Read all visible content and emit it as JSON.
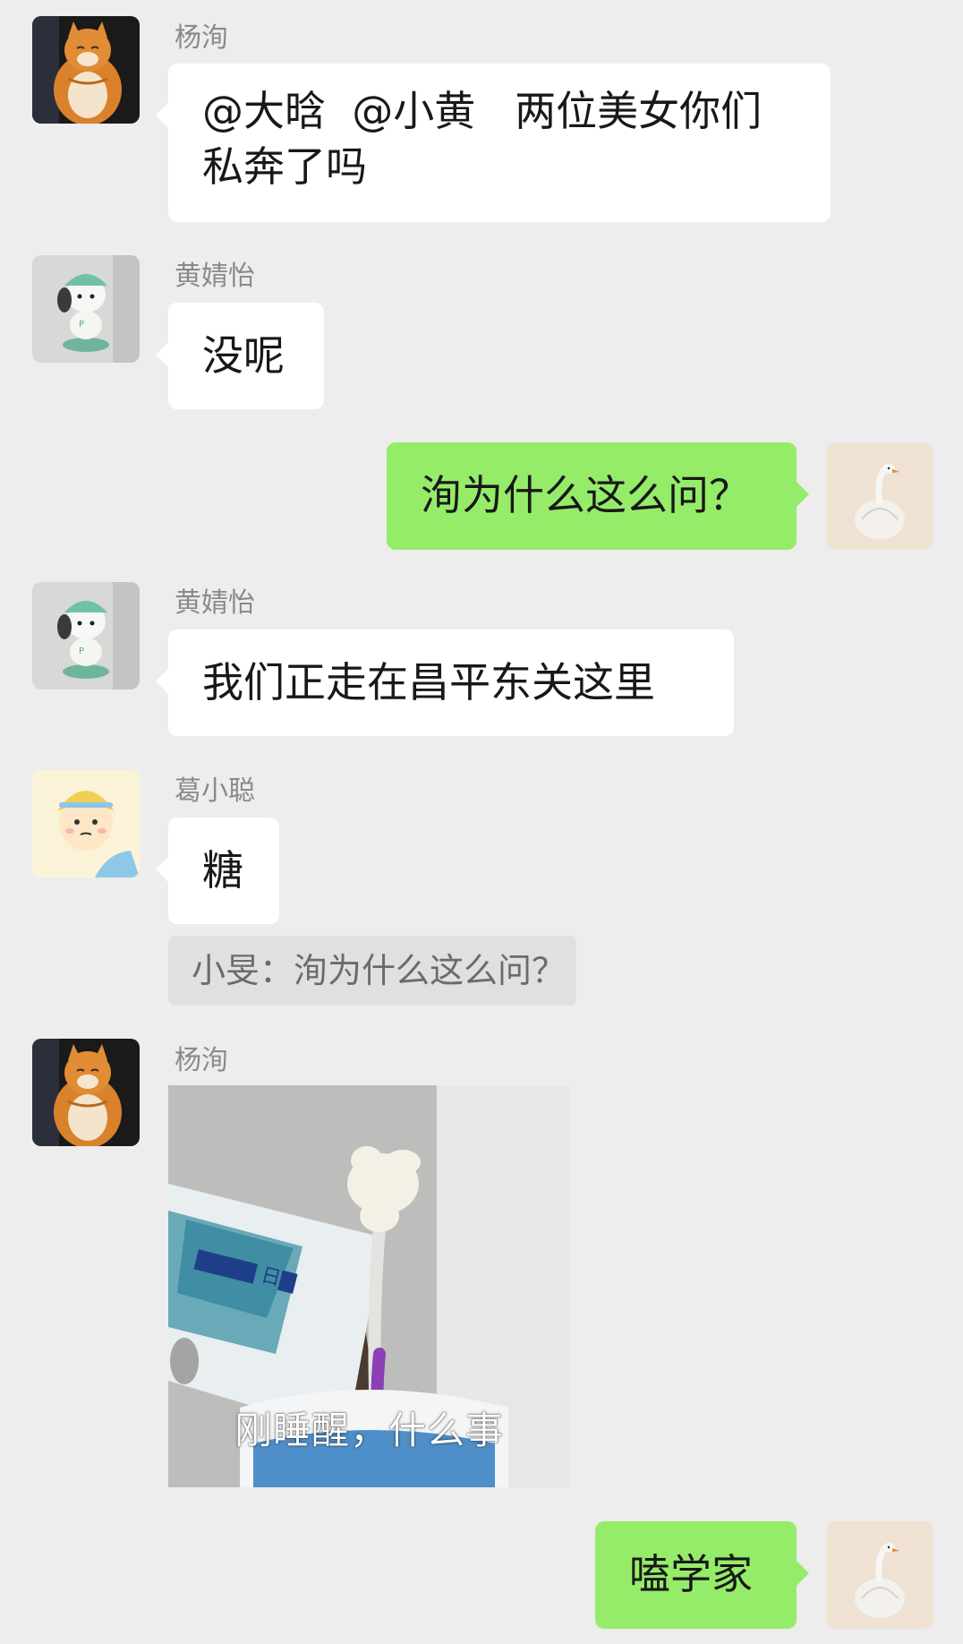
{
  "messages": [
    {
      "sender": "杨洵",
      "text_line1": "@大晗  @小黄   两位美女你们",
      "text_line2": "私奔了吗"
    },
    {
      "sender": "黄婧怡",
      "text": "没呢"
    },
    {
      "text": "洵为什么这么问？"
    },
    {
      "sender": "黄婧怡",
      "text": "我们正走在昌平东关这里"
    },
    {
      "sender": "葛小聪",
      "text": "糖",
      "quote": "小旻：洵为什么这么问？"
    },
    {
      "sender": "杨洵",
      "sticker_caption": "刚睡醒，什么事"
    },
    {
      "text": "嗑学家"
    }
  ],
  "colors": {
    "background": "#ededed",
    "incoming_bubble": "#ffffff",
    "outgoing_bubble": "#95ec69",
    "quote_bubble": "#e0e0e0",
    "sender_name": "#8a8a8a"
  },
  "avatars": {
    "yangxun": "orange-cat-avatar",
    "huangjingyi": "pochacco-figure-avatar",
    "gexiaocong": "cartoon-boy-avatar",
    "me": "swan-garlic-avatar"
  }
}
